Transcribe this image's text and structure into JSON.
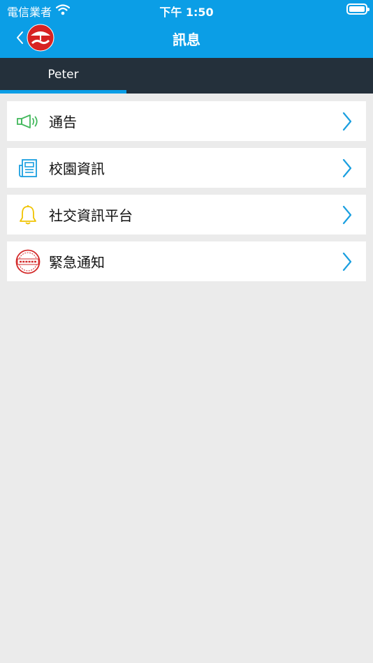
{
  "status_bar": {
    "carrier": "電信業者",
    "time": "下午 1:50"
  },
  "nav": {
    "title": "訊息"
  },
  "tabs": [
    {
      "label": "Peter"
    }
  ],
  "menu": [
    {
      "label": "通告",
      "icon": "megaphone-icon",
      "color": "#43b85c"
    },
    {
      "label": "校園資訊",
      "icon": "newspaper-icon",
      "color": "#1a9fe0"
    },
    {
      "label": "社交資訊平台",
      "icon": "bell-icon",
      "color": "#f0c300"
    },
    {
      "label": "緊急通知",
      "icon": "urgent-stamp-icon",
      "color": "#d32a2a"
    }
  ],
  "colors": {
    "header": "#0b9ee6",
    "tab_bar": "#24303b",
    "background": "#ebebeb",
    "chevron": "#1a9fe0"
  }
}
